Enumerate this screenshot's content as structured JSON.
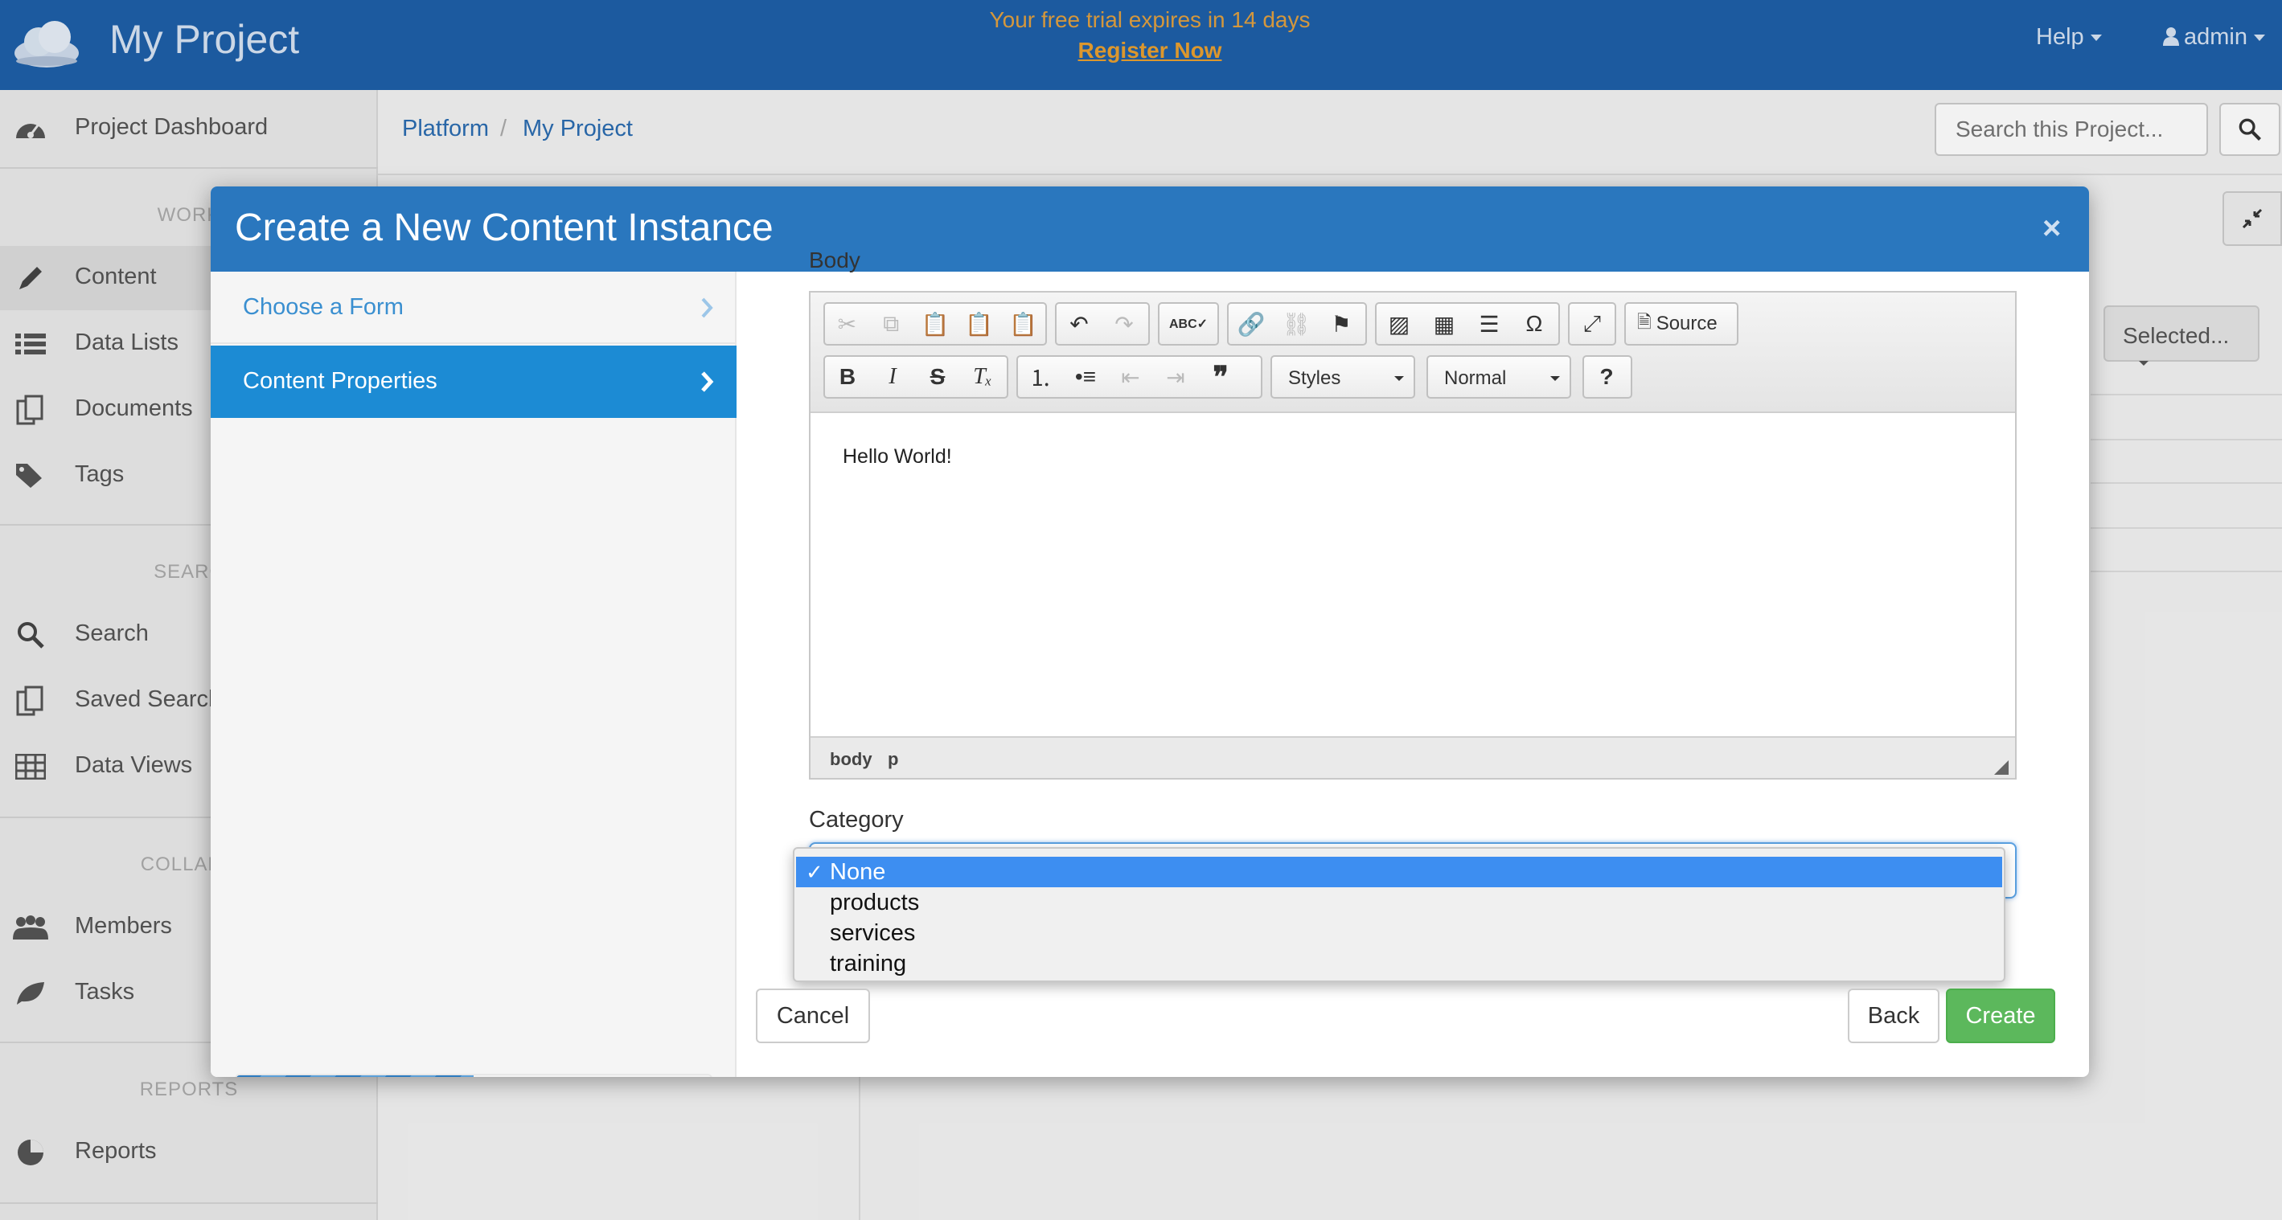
{
  "navbar": {
    "brand": "My Project",
    "trial_text": "Your free trial expires in 14 days",
    "register_link": "Register Now",
    "help_label": "Help",
    "user_label": "admin",
    "bar_color": "#1e5fa8"
  },
  "sidebar": {
    "items": [
      {
        "label": "Project Dashboard",
        "icon": "dashboard-icon"
      },
      {
        "label": "Content",
        "icon": "pencil-icon"
      },
      {
        "label": "Data Lists",
        "icon": "list-icon"
      },
      {
        "label": "Documents",
        "icon": "documents-icon"
      },
      {
        "label": "Tags",
        "icon": "tags-icon"
      },
      {
        "label": "Search",
        "icon": "search-icon"
      },
      {
        "label": "Saved Search",
        "icon": "saved-search-icon"
      },
      {
        "label": "Data Views",
        "icon": "table-icon"
      },
      {
        "label": "Members",
        "icon": "members-icon"
      },
      {
        "label": "Tasks",
        "icon": "leaf-icon"
      },
      {
        "label": "Reports",
        "icon": "pie-chart-icon"
      }
    ],
    "headings": [
      "WORK",
      "SEARC",
      "COLLABO",
      "REPORTS"
    ]
  },
  "breadcrumb": {
    "items": [
      "Platform",
      "My Project"
    ],
    "separator": "/"
  },
  "project_search": {
    "placeholder": "Search this Project..."
  },
  "background": {
    "selected_label": "Selected..."
  },
  "modal": {
    "title": "Create a New Content Instance",
    "close_label": "×",
    "header_color": "#2a77be",
    "steps": [
      "Choose a Form",
      "Content Properties"
    ],
    "active_step": "Content Properties",
    "progress_percent": 50,
    "body_label": "Body",
    "editor": {
      "styles_label": "Styles",
      "format_label": "Normal",
      "source_label": "Source",
      "content_text": "Hello World!",
      "path": [
        "body",
        "p"
      ]
    },
    "category": {
      "label": "Category",
      "options": [
        "None",
        "products",
        "services",
        "training"
      ],
      "selected": "None",
      "check_mark": "✓"
    },
    "buttons": {
      "cancel": "Cancel",
      "back": "Back",
      "create": "Create"
    },
    "create_color": "#5cb85c",
    "active_step_color": "#1c8bd4"
  }
}
